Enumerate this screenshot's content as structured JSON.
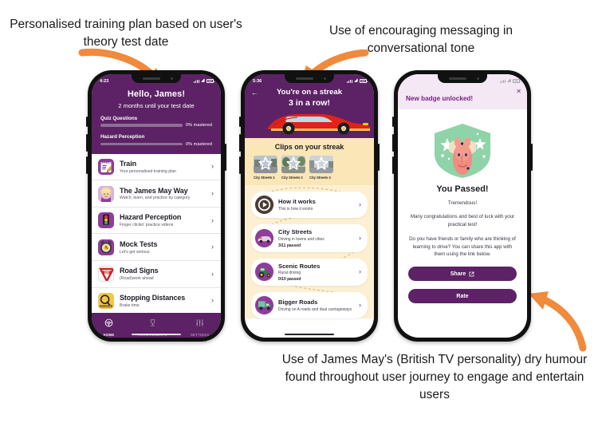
{
  "annotations": {
    "left": "Personalised training plan based on user's theory test date",
    "middle": "Use of encouraging messaging in conversational tone",
    "bottom": "Use of James May's (British TV personality) dry humour found throughout user journey to engage and entertain users"
  },
  "colors": {
    "brand_purple": "#5c2265",
    "accent_orange": "#f08a3c",
    "cream": "#fae6b6",
    "cream_light": "#fdf0d2",
    "badge_green": "#8fd3a8",
    "banner_lilac": "#f3e8f3"
  },
  "phone1": {
    "status": {
      "time": "4:23",
      "wifi_icon": "wifi-icon",
      "battery_icon": "battery-icon",
      "signal_icon": "signal-icon"
    },
    "header": {
      "greeting": "Hello, James!",
      "subtitle": "2 months until your test date",
      "progress": [
        {
          "label": "Quiz Questions",
          "value": "0% mastered",
          "percent": 0
        },
        {
          "label": "Hazard Perception",
          "value": "0% mastered",
          "percent": 0
        }
      ]
    },
    "list": [
      {
        "title": "Train",
        "desc": "Your personalised training plan",
        "icon": "notepad-icon"
      },
      {
        "title": "The James May Way",
        "desc": "Watch, learn, and practice by category",
        "icon": "james-may-face-icon"
      },
      {
        "title": "Hazard Perception",
        "desc": "Finger clickin' practice videos",
        "icon": "traffic-light-icon"
      },
      {
        "title": "Mock Tests",
        "desc": "Let's get serious",
        "icon": "alarm-clock-icon"
      },
      {
        "title": "Road Signs",
        "desc": "(Road)work ahead",
        "icon": "give-way-sign-icon"
      },
      {
        "title": "Stopping Distances",
        "desc": "Brake time",
        "icon": "ruler-icon"
      }
    ],
    "nav": [
      {
        "label": "HOME",
        "icon": "steering-wheel-icon",
        "active": true
      },
      {
        "label": "ACHIEVEMENTS",
        "icon": "trophy-icon",
        "active": false
      },
      {
        "label": "SETTINGS",
        "icon": "sliders-icon",
        "active": false
      }
    ]
  },
  "phone2": {
    "status": {
      "time": "5:36",
      "wifi_icon": "wifi-icon",
      "battery_icon": "battery-icon",
      "signal_icon": "signal-icon"
    },
    "header": {
      "back_icon": "back-arrow-icon",
      "line1": "You're on a streak",
      "line2": "3 in a row!",
      "hero_icon": "red-sports-car-icon"
    },
    "clips": {
      "heading": "Clips on your streak",
      "thumbs": [
        {
          "caption": "City Streets 1",
          "badge": "star-icon"
        },
        {
          "caption": "City Streets 2",
          "badge": "star-icon"
        },
        {
          "caption": "City Streets 3",
          "badge": "star-icon"
        }
      ]
    },
    "cards": [
      {
        "title": "How it works",
        "desc": "This is how it works",
        "passed": "",
        "icon": "play-button-icon"
      },
      {
        "title": "City Streets",
        "desc": "Driving in towns and cities",
        "passed": "3/11 passed",
        "icon": "city-car-icon"
      },
      {
        "title": "Scenic Routes",
        "desc": "Rural driving",
        "passed": "0/10 passed",
        "icon": "tractor-icon"
      },
      {
        "title": "Bigger Roads",
        "desc": "Driving on A roads and dual carriageways",
        "passed": "",
        "icon": "lorry-icon"
      }
    ]
  },
  "phone3": {
    "status": {
      "time": "",
      "wifi_icon": "wifi-icon",
      "battery_icon": "battery-icon",
      "signal_icon": "signal-icon"
    },
    "banner": {
      "title": "New badge unlocked!",
      "close_icon": "close-icon"
    },
    "badge_icon": "passed-badge-icon",
    "heading": "You Passed!",
    "sub": "Tremendous!",
    "paragraph1": "Many congratulations and best of luck with your practical test!",
    "paragraph2": "Do you have friends or family who are thinking of learning to drive? You can share this app with them using the link below.",
    "buttons": [
      {
        "label": "Share",
        "icon": "external-link-icon"
      },
      {
        "label": "Rate",
        "icon": ""
      }
    ]
  }
}
